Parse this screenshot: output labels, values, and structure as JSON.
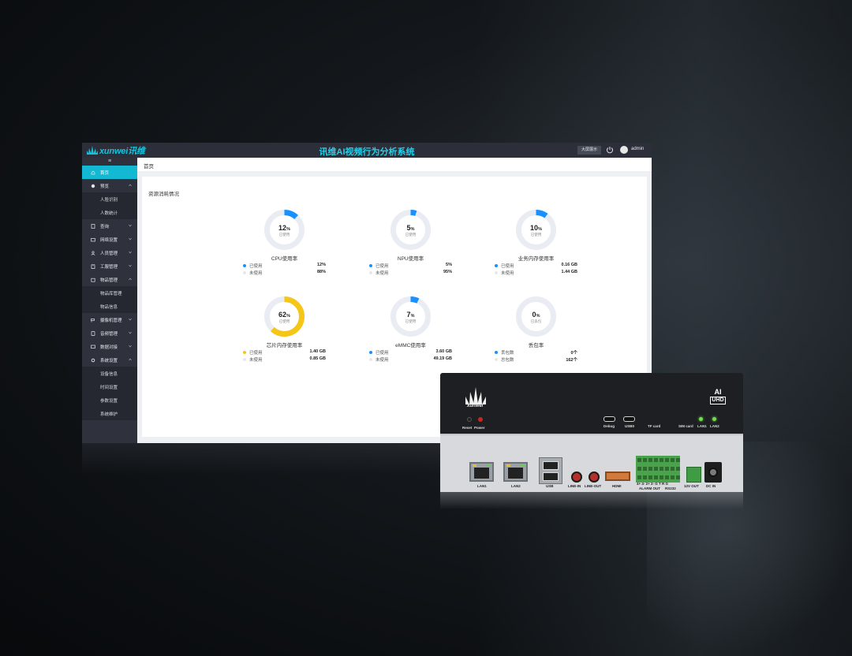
{
  "header": {
    "logo_text": "xunwei讯维",
    "title": "讯维AI视频行为分析系统",
    "big_screen_button": "大屏展示",
    "user": "admin"
  },
  "sidebar": {
    "toggle": "≡",
    "items": [
      {
        "label": "首页",
        "icon": "home-icon",
        "active": true
      },
      {
        "label": "预览",
        "icon": "camera-icon",
        "expanded": true
      },
      {
        "label": "人脸识别",
        "sub": true
      },
      {
        "label": "人数统计",
        "sub": true
      },
      {
        "label": "查询",
        "icon": "document-icon"
      },
      {
        "label": "网络设置",
        "icon": "folder-icon"
      },
      {
        "label": "人员管理",
        "icon": "user-icon"
      },
      {
        "label": "工服管理",
        "icon": "shirt-icon"
      },
      {
        "label": "物品管理",
        "icon": "box-icon",
        "expanded": true
      },
      {
        "label": "物品库管理",
        "sub": true
      },
      {
        "label": "物品信息",
        "sub": true
      },
      {
        "label": "摄像机管理",
        "icon": "cctv-icon"
      },
      {
        "label": "音频管理",
        "icon": "speaker-icon"
      },
      {
        "label": "数据对接",
        "icon": "link-icon"
      },
      {
        "label": "系统设置",
        "icon": "gear-icon",
        "expanded": true
      },
      {
        "label": "设备信息",
        "sub": true
      },
      {
        "label": "时间设置",
        "sub": true
      },
      {
        "label": "参数设置",
        "sub": true
      },
      {
        "label": "系统维护",
        "sub": true
      }
    ]
  },
  "breadcrumb": "首页",
  "section_title": "资源消耗情况",
  "cards": [
    {
      "pct": 12,
      "center_sub": "已使用",
      "label": "CPU使用率",
      "color": "#1890ff",
      "rows": [
        {
          "name": "已使用",
          "value": "12%",
          "dot": "#1890ff"
        },
        {
          "name": "未使用",
          "value": "88%",
          "dot": "#e6e8ee"
        }
      ]
    },
    {
      "pct": 5,
      "center_sub": "已使用",
      "label": "NPU使用率",
      "color": "#1890ff",
      "rows": [
        {
          "name": "已使用",
          "value": "5%",
          "dot": "#1890ff"
        },
        {
          "name": "未使用",
          "value": "95%",
          "dot": "#e6e8ee"
        }
      ]
    },
    {
      "pct": 10,
      "center_sub": "已使用",
      "label": "业务内存使用率",
      "color": "#1890ff",
      "rows": [
        {
          "name": "已使用",
          "value": "0.16 GB",
          "dot": "#1890ff"
        },
        {
          "name": "未使用",
          "value": "1.44 GB",
          "dot": "#e6e8ee"
        }
      ]
    },
    {
      "pct": 62,
      "center_sub": "已使用",
      "label": "芯片内存使用率",
      "color": "#f5c518",
      "rows": [
        {
          "name": "已使用",
          "value": "1.40 GB",
          "dot": "#f5c518"
        },
        {
          "name": "未使用",
          "value": "0.85 GB",
          "dot": "#e6e8ee"
        }
      ]
    },
    {
      "pct": 7,
      "center_sub": "已使用",
      "label": "eMMC使用率",
      "color": "#1890ff",
      "rows": [
        {
          "name": "已使用",
          "value": "3.60 GB",
          "dot": "#1890ff"
        },
        {
          "name": "未使用",
          "value": "49.19 GB",
          "dot": "#e6e8ee"
        }
      ]
    },
    {
      "pct": 0,
      "center_sub": "已丢包",
      "label": "丢包率",
      "color": "#1890ff",
      "rows": [
        {
          "name": "丢包数",
          "value": "0个",
          "dot": "#1890ff"
        },
        {
          "name": "总包数",
          "value": "162个",
          "dot": "#e6e8ee"
        }
      ]
    }
  ],
  "device": {
    "logo_text": "xunwei",
    "ai": "AI",
    "uhd": "UHD",
    "front_labels": {
      "reset": "Reset",
      "power": "Power",
      "debug": "Debug",
      "usb": "USB0",
      "tf": "TF card",
      "sim": "SIM card",
      "lan1": "LAN1",
      "lan2": "LAN2"
    },
    "back_labels": {
      "lan1": "LAN1",
      "lan2": "LAN2",
      "usb": "USB",
      "line_in": "LINE-IN",
      "line_out": "LINE-OUT",
      "hdmi": "HDMI",
      "alarm": "ALARM OUT",
      "alarm_pins": "4+ 4- 2+ 2- G T R G",
      "rs232": "RS232",
      "v12": "12V OUT",
      "dcin": "DC IN"
    }
  }
}
